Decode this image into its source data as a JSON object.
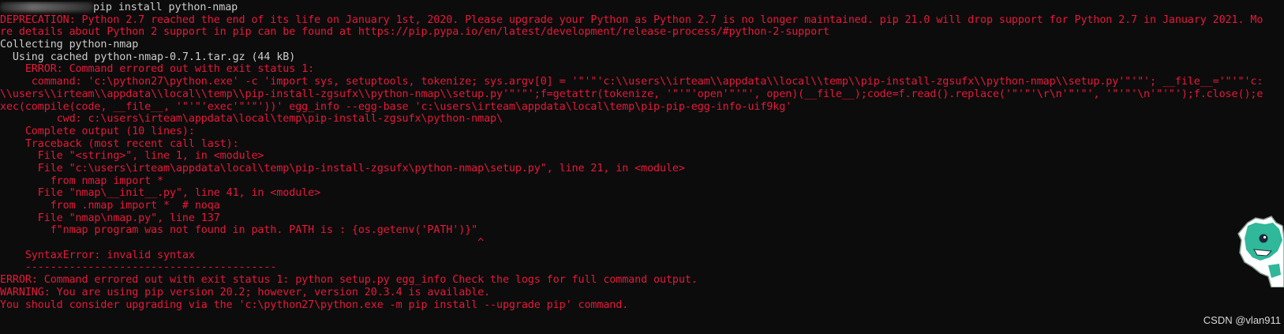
{
  "terminal": {
    "lines": [
      {
        "color": "white",
        "text": "pip install python-nmap"
      },
      {
        "color": "red",
        "text": "DEPRECATION: Python 2.7 reached the end of its life on January 1st, 2020. Please upgrade your Python as Python 2.7 is no longer maintained. pip 21.0 will drop support for Python 2.7 in January 2021. Mo"
      },
      {
        "color": "red",
        "text": "re details about Python 2 support in pip can be found at https://pip.pypa.io/en/latest/development/release-process/#python-2-support"
      },
      {
        "color": "white",
        "text": "Collecting python-nmap"
      },
      {
        "color": "white",
        "text": "  Using cached python-nmap-0.7.1.tar.gz (44 kB)"
      },
      {
        "color": "red",
        "text": "    ERROR: Command errored out with exit status 1:"
      },
      {
        "color": "red",
        "text": "     command: 'c:\\python27\\python.exe' -c 'import sys, setuptools, tokenize; sys.argv[0] = '\"'\"'c:\\\\users\\\\irteam\\\\appdata\\\\local\\\\temp\\\\pip-install-zgsufx\\\\python-nmap\\\\setup.py'\"'\"'; __file__='\"'\"'c:"
      },
      {
        "color": "red",
        "text": "\\\\users\\\\irteam\\\\appdata\\\\local\\\\temp\\\\pip-install-zgsufx\\\\python-nmap\\\\setup.py'\"'\"';f=getattr(tokenize, '\"'\"'open'\"'\"', open)(__file__);code=f.read().replace('\"'\"'\\r\\n'\"'\"', '\"'\"'\\n'\"'\"');f.close();e"
      },
      {
        "color": "red",
        "text": "xec(compile(code, __file__, '\"'\"'exec'\"'\"'))' egg_info --egg-base 'c:\\users\\irteam\\appdata\\local\\temp\\pip-pip-egg-info-uif9kg'"
      },
      {
        "color": "red",
        "text": "         cwd: c:\\users\\irteam\\appdata\\local\\temp\\pip-install-zgsufx\\python-nmap\\"
      },
      {
        "color": "red",
        "text": "    Complete output (10 lines):"
      },
      {
        "color": "red",
        "text": "    Traceback (most recent call last):"
      },
      {
        "color": "red",
        "text": "      File \"<string>\", line 1, in <module>"
      },
      {
        "color": "red",
        "text": "      File \"c:\\users\\irteam\\appdata\\local\\temp\\pip-install-zgsufx\\python-nmap\\setup.py\", line 21, in <module>"
      },
      {
        "color": "red",
        "text": "        from nmap import *"
      },
      {
        "color": "red",
        "text": "      File \"nmap\\__init__.py\", line 41, in <module>"
      },
      {
        "color": "red",
        "text": "        from .nmap import *  # noqa"
      },
      {
        "color": "red",
        "text": "      File \"nmap\\nmap.py\", line 137"
      },
      {
        "color": "red",
        "text": "        f\"nmap program was not found in path. PATH is : {os.getenv('PATH')}\""
      },
      {
        "color": "red",
        "text": "                                                                            ^"
      },
      {
        "color": "red",
        "text": "    SyntaxError: invalid syntax"
      },
      {
        "color": "red",
        "text": "    ----------------------------------------"
      },
      {
        "color": "red",
        "text": "ERROR: Command errored out with exit status 1: python setup.py egg_info Check the logs for full command output."
      },
      {
        "color": "red",
        "text": "WARNING: You are using pip version 20.2; however, version 20.3.4 is available."
      },
      {
        "color": "red",
        "text": "You should consider upgrading via the 'c:\\python27\\python.exe -m pip install --upgrade pip' command."
      }
    ]
  },
  "watermark": {
    "text": "CSDN @vlan911"
  },
  "colors": {
    "red": "#e6193a",
    "white": "#cccccc",
    "background": "#0c0c0c"
  }
}
